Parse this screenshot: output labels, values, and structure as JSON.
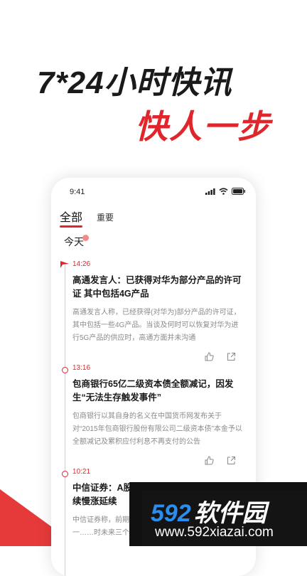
{
  "promo": {
    "headline": "7*24小时快讯",
    "subline": "快人一步"
  },
  "colors": {
    "accent": "#e0262b",
    "text": "#1a1a1a",
    "muted": "#8a8a8a"
  },
  "status_bar": {
    "time": "9:41",
    "icons": [
      "signal-icon",
      "wifi-icon",
      "battery-icon"
    ]
  },
  "tabs": [
    {
      "label": "全部",
      "active": true
    },
    {
      "label": "重要",
      "active": false
    }
  ],
  "date_label": "今天",
  "news": [
    {
      "time": "14:26",
      "title": "高通发言人：已获得对华为部分产品的许可证 其中包括4G产品",
      "body": "高通发言人称，已经获得(对华为)部分产品的许可证，其中包括一些4G产品。当谈及何时可以恢复对华为进行5G产品的供应时，高通方面并未沟通",
      "actions": [
        "thumbs-up-icon",
        "share-icon"
      ]
    },
    {
      "time": "13:16",
      "title": "包商银行65亿二级资本债全额减记，因发生“无法生存触发事件”",
      "body": "包商银行以其自身的名义在中国货币网发布关于对“2015年包商银行股份有限公司二级资本债”本金予以全额减记及累积应付利息不再支付的公告",
      "actions": [
        "thumbs-up-icon",
        "share-icon"
      ]
    },
    {
      "time": "10:21",
      "title": "中信证券：A股两大压制消除，轮动慢涨延续慢涨延续",
      "body": "中信证券称，前期A股两大压制……基本面持续恢复进一……时未来三个月重大政策和外部因素……",
      "actions": []
    }
  ],
  "watermark": {
    "logo_number": "592",
    "logo_text": "软件园",
    "url": "www.592xiazai.com"
  }
}
